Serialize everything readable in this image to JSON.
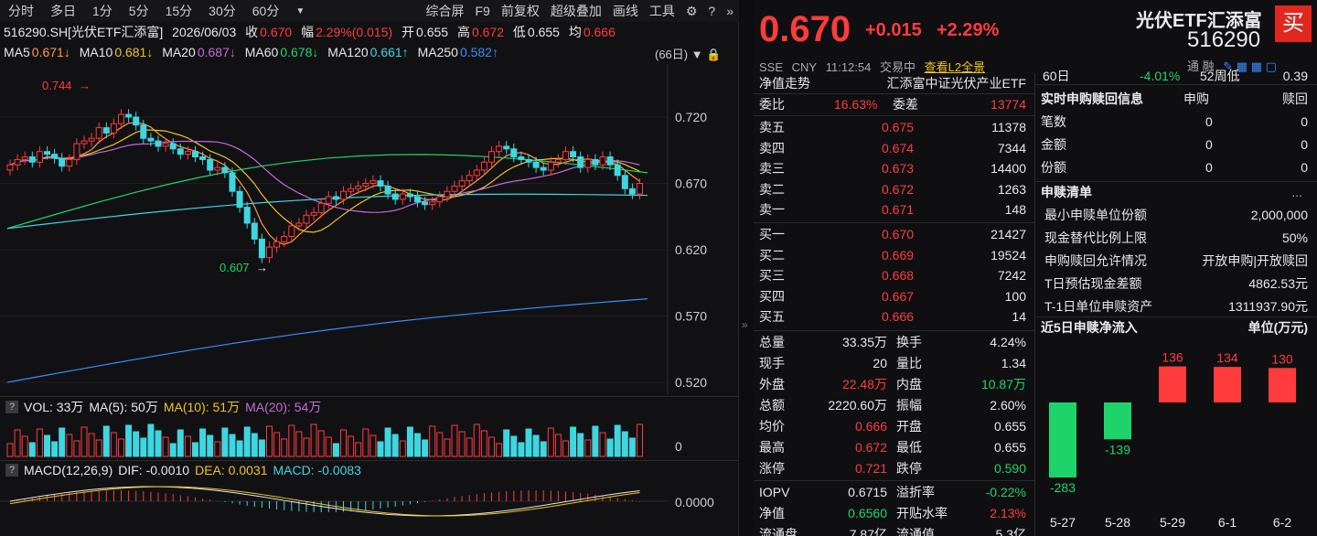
{
  "toolbar": {
    "periods": [
      "分时",
      "多日",
      "1分",
      "5分",
      "15分",
      "30分",
      "60分"
    ],
    "dropdown_icon": "triangle-down-icon",
    "right_items": [
      "综合屏",
      "F9",
      "前复权",
      "超级叠加",
      "画线",
      "工具"
    ],
    "icons": [
      "gear-icon",
      "help-icon",
      "double-chevron-right-icon"
    ]
  },
  "info": {
    "code_name": "516290.SH[光伏ETF汇添富]",
    "date": "2026/06/03",
    "close_label": "收",
    "close_value": "0.670",
    "range_label": "幅",
    "range_value": "2.29%(0.015)",
    "open_label": "开",
    "open_value": "0.655",
    "high_label": "高",
    "high_value": "0.672",
    "low_label": "低",
    "low_value": "0.655",
    "avg_label": "均",
    "avg_value": "0.666"
  },
  "ma": [
    {
      "label": "MA5",
      "value": "0.671↓",
      "color": "#ff9a3c"
    },
    {
      "label": "MA10",
      "value": "0.681↓",
      "color": "#f0c419"
    },
    {
      "label": "MA20",
      "value": "0.687↓",
      "color": "#c56bd8"
    },
    {
      "label": "MA60",
      "value": "0.678↓",
      "color": "#1fd36b"
    },
    {
      "label": "MA120",
      "value": "0.661↑",
      "color": "#3ed6e0"
    },
    {
      "label": "MA250",
      "value": "0.582↑",
      "color": "#3b8cff"
    }
  ],
  "days_selector": "(66日)",
  "chart": {
    "price_ticks": [
      "0.720",
      "0.670",
      "0.620",
      "0.570",
      "0.520"
    ],
    "high_marker": "0.744",
    "low_marker": "0.607"
  },
  "volume": {
    "title": "VOL: 33万",
    "ma5": "MA(5): 50万",
    "ma10": "MA(10): 51万",
    "ma20": "MA(20): 54万",
    "tick": "0"
  },
  "macd": {
    "title": "MACD(12,26,9)",
    "dif": "DIF: -0.0010",
    "dea": "DEA: 0.0031",
    "macd": "MACD: -0.0083",
    "tick": "0.0000"
  },
  "quote": {
    "price": "0.670",
    "change": "+0.015",
    "change_pct": "+2.29%",
    "name": "光伏ETF汇添富",
    "code": "516290",
    "buy_label": "买",
    "exchange": "SSE",
    "currency": "CNY",
    "time": "11:12:54",
    "status": "交易中",
    "l2_link": "查看L2全景",
    "tongji": "通 融"
  },
  "book": {
    "nav_trend_label": "净值走势",
    "index_name": "汇添富中证光伏产业ETF",
    "weibi_label": "委比",
    "weibi_value": "16.63%",
    "weicha_label": "委差",
    "weicha_value": "13774",
    "asks": [
      {
        "label": "卖五",
        "price": "0.675",
        "vol": "11378"
      },
      {
        "label": "卖四",
        "price": "0.674",
        "vol": "7344"
      },
      {
        "label": "卖三",
        "price": "0.673",
        "vol": "14400"
      },
      {
        "label": "卖二",
        "price": "0.672",
        "vol": "1263"
      },
      {
        "label": "卖一",
        "price": "0.671",
        "vol": "148"
      }
    ],
    "bids": [
      {
        "label": "买一",
        "price": "0.670",
        "vol": "21427"
      },
      {
        "label": "买二",
        "price": "0.669",
        "vol": "19524"
      },
      {
        "label": "买三",
        "price": "0.668",
        "vol": "7242"
      },
      {
        "label": "买四",
        "price": "0.667",
        "vol": "100"
      },
      {
        "label": "买五",
        "price": "0.666",
        "vol": "14"
      }
    ]
  },
  "stats": [
    {
      "l1": "总量",
      "v1": "33.35万",
      "c1": "#e8e8e8",
      "l2": "换手",
      "v2": "4.24%",
      "c2": "#e8e8e8"
    },
    {
      "l1": "现手",
      "v1": "20",
      "c1": "#e8e8e8",
      "l2": "量比",
      "v2": "1.34",
      "c2": "#e8e8e8"
    },
    {
      "l1": "外盘",
      "v1": "22.48万",
      "c1": "#ff3b3b",
      "l2": "内盘",
      "v2": "10.87万",
      "c2": "#1fd36b"
    },
    {
      "l1": "总额",
      "v1": "2220.60万",
      "c1": "#e8e8e8",
      "l2": "振幅",
      "v2": "2.60%",
      "c2": "#e8e8e8"
    },
    {
      "l1": "均价",
      "v1": "0.666",
      "c1": "#ff3b3b",
      "l2": "开盘",
      "v2": "0.655",
      "c2": "#e8e8e8"
    },
    {
      "l1": "最高",
      "v1": "0.672",
      "c1": "#ff3b3b",
      "l2": "最低",
      "v2": "0.655",
      "c2": "#e8e8e8"
    },
    {
      "l1": "涨停",
      "v1": "0.721",
      "c1": "#ff3b3b",
      "l2": "跌停",
      "v2": "0.590",
      "c2": "#1fd36b"
    }
  ],
  "stats2": [
    {
      "l1": "IOPV",
      "v1": "0.6715",
      "c1": "#e8e8e8",
      "l2": "溢折率",
      "v2": "-0.22%",
      "c2": "#1fd36b"
    },
    {
      "l1": "净值",
      "v1": "0.6560",
      "c1": "#1fd36b",
      "l2": "开贴水率",
      "v2": "2.13%",
      "c2": "#ff3b3b"
    },
    {
      "l1": "流通盘",
      "v1": "7.87亿",
      "c1": "#e8e8e8",
      "l2": "流通值",
      "v2": "5.3亿",
      "c2": "#e8e8e8"
    }
  ],
  "side": {
    "top_row": {
      "label": "60日",
      "value": "-4.01%",
      "label2": "52周低",
      "value2": "0.39"
    },
    "realtime_title": "实时申购赎回信息",
    "realtime_h1": "申购",
    "realtime_h2": "赎回",
    "realtime_rows": [
      {
        "label": "笔数",
        "a": "0",
        "b": "0"
      },
      {
        "label": "金额",
        "a": "0",
        "b": "0"
      },
      {
        "label": "份额",
        "a": "0",
        "b": "0"
      }
    ],
    "list_title": "申赎清单",
    "more": "...",
    "list_rows": [
      {
        "label": "最小申赎单位份额",
        "value": "2,000,000"
      },
      {
        "label": "现金替代比例上限",
        "value": "50%"
      },
      {
        "label": "申购赎回允许情况",
        "value": "开放申购|开放赎回"
      },
      {
        "label": "T日预估现金差额",
        "value": "4862.53元"
      },
      {
        "label": "T-1日单位申赎资产",
        "value": "1311937.90元"
      }
    ],
    "flow_title": "近5日申赎净流入",
    "flow_unit": "单位(万元)"
  },
  "chart_data": {
    "type": "bar",
    "categories": [
      "5-27",
      "5-28",
      "5-29",
      "6-1",
      "6-2"
    ],
    "values": [
      -283,
      -139,
      136,
      134,
      130
    ],
    "title": "近5日申赎净流入",
    "ylabel": "单位(万元)"
  },
  "colors": {
    "up": "#ff3b3b",
    "down": "#1fd36b",
    "candle_down": "#3ed6e0",
    "bg": "#0f0f12"
  }
}
